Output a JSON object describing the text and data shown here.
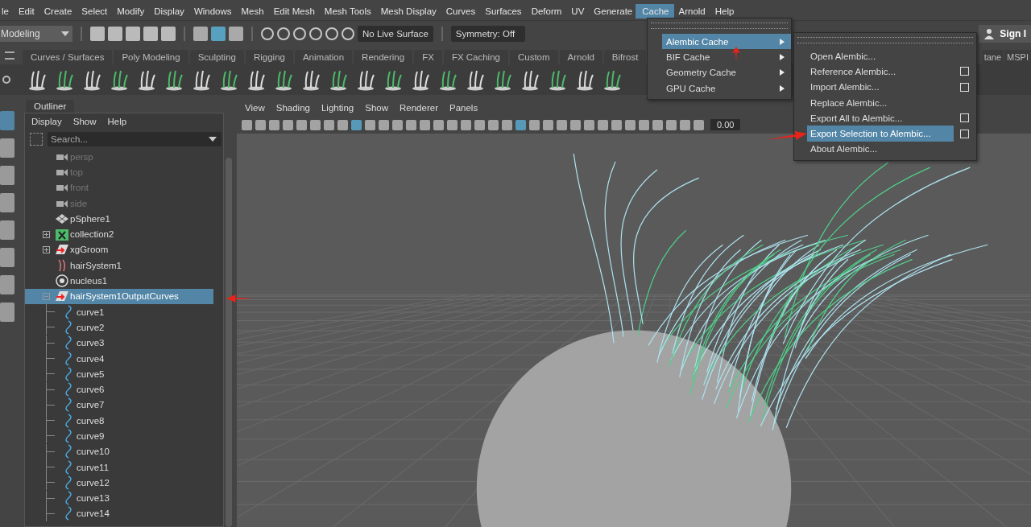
{
  "menu_bar": {
    "items": [
      {
        "label": "le",
        "selected": false
      },
      {
        "label": "Edit",
        "selected": false
      },
      {
        "label": "Create",
        "selected": false
      },
      {
        "label": "Select",
        "selected": false
      },
      {
        "label": "Modify",
        "selected": false
      },
      {
        "label": "Display",
        "selected": false
      },
      {
        "label": "Windows",
        "selected": false
      },
      {
        "label": "Mesh",
        "selected": false
      },
      {
        "label": "Edit Mesh",
        "selected": false
      },
      {
        "label": "Mesh Tools",
        "selected": false
      },
      {
        "label": "Mesh Display",
        "selected": false
      },
      {
        "label": "Curves",
        "selected": false
      },
      {
        "label": "Surfaces",
        "selected": false
      },
      {
        "label": "Deform",
        "selected": false
      },
      {
        "label": "UV",
        "selected": false
      },
      {
        "label": "Generate",
        "selected": false
      },
      {
        "label": "Cache",
        "selected": true
      },
      {
        "label": "Arnold",
        "selected": false
      },
      {
        "label": "Help",
        "selected": false
      }
    ]
  },
  "status_line": {
    "mode": "Modeling",
    "live_surface": "No Live Surface",
    "symmetry": "Symmetry: Off",
    "sign_in": "Sign I"
  },
  "shelf_tabs": [
    "Curves / Surfaces",
    "Poly Modeling",
    "Sculpting",
    "Rigging",
    "Animation",
    "Rendering",
    "FX",
    "FX Caching",
    "Custom",
    "Arnold",
    "Bifrost"
  ],
  "shelf_tabs_right": [
    "tane",
    "MSPI"
  ],
  "outliner": {
    "title": "Outliner",
    "menus": [
      "Display",
      "Show",
      "Help"
    ],
    "search": {
      "placeholder": "Search..."
    },
    "items": [
      {
        "label": "persp",
        "kind": "camera",
        "dimmed": true,
        "selected": false
      },
      {
        "label": "top",
        "kind": "camera",
        "dimmed": true,
        "selected": false
      },
      {
        "label": "front",
        "kind": "camera",
        "dimmed": true,
        "selected": false
      },
      {
        "label": "side",
        "kind": "camera",
        "dimmed": true,
        "selected": false
      },
      {
        "label": "pSphere1",
        "kind": "mesh",
        "dimmed": false,
        "selected": false
      },
      {
        "label": "collection2",
        "kind": "collection",
        "dimmed": false,
        "selected": false,
        "expanded": false
      },
      {
        "label": "xgGroom",
        "kind": "group",
        "dimmed": false,
        "selected": false,
        "expanded": false
      },
      {
        "label": "hairSystem1",
        "kind": "hair",
        "dimmed": false,
        "selected": false
      },
      {
        "label": "nucleus1",
        "kind": "nucleus",
        "dimmed": false,
        "selected": false
      },
      {
        "label": "hairSystem1OutputCurves",
        "kind": "group",
        "dimmed": false,
        "selected": true,
        "expanded": true,
        "children": [
          {
            "label": "curve1",
            "kind": "curve",
            "dimmed": false,
            "selected": false
          },
          {
            "label": "curve2",
            "kind": "curve",
            "dimmed": false,
            "selected": false
          },
          {
            "label": "curve3",
            "kind": "curve",
            "dimmed": false,
            "selected": false
          },
          {
            "label": "curve4",
            "kind": "curve",
            "dimmed": false,
            "selected": false
          },
          {
            "label": "curve5",
            "kind": "curve",
            "dimmed": false,
            "selected": false
          },
          {
            "label": "curve6",
            "kind": "curve",
            "dimmed": false,
            "selected": false
          },
          {
            "label": "curve7",
            "kind": "curve",
            "dimmed": false,
            "selected": false
          },
          {
            "label": "curve8",
            "kind": "curve",
            "dimmed": false,
            "selected": false
          },
          {
            "label": "curve9",
            "kind": "curve",
            "dimmed": false,
            "selected": false
          },
          {
            "label": "curve10",
            "kind": "curve",
            "dimmed": false,
            "selected": false
          },
          {
            "label": "curve11",
            "kind": "curve",
            "dimmed": false,
            "selected": false
          },
          {
            "label": "curve12",
            "kind": "curve",
            "dimmed": false,
            "selected": false
          },
          {
            "label": "curve13",
            "kind": "curve",
            "dimmed": false,
            "selected": false
          },
          {
            "label": "curve14",
            "kind": "curve",
            "dimmed": false,
            "selected": false
          }
        ]
      }
    ]
  },
  "viewport": {
    "menus": [
      "View",
      "Shading",
      "Lighting",
      "Show",
      "Renderer",
      "Panels"
    ],
    "exposure": "0.00"
  },
  "cache_menu": {
    "items": [
      {
        "label": "Alembic Cache",
        "selected": true,
        "submenu": true
      },
      {
        "label": "BIF Cache",
        "selected": false,
        "submenu": true
      },
      {
        "label": "Geometry Cache",
        "selected": false,
        "submenu": true
      },
      {
        "label": "GPU Cache",
        "selected": false,
        "submenu": true
      }
    ]
  },
  "alembic_menu": {
    "items": [
      {
        "label": "Open Alembic...",
        "selected": false,
        "option_box": false
      },
      {
        "label": "Reference Alembic...",
        "selected": false,
        "option_box": true
      },
      {
        "label": "Import Alembic...",
        "selected": false,
        "option_box": true
      },
      {
        "label": "Replace Alembic...",
        "selected": false,
        "option_box": false
      },
      {
        "label": "Export All to Alembic...",
        "selected": false,
        "option_box": true
      },
      {
        "label": "Export Selection to Alembic...",
        "selected": true,
        "option_box": true
      },
      {
        "label": "About Alembic...",
        "selected": false,
        "option_box": false
      }
    ]
  }
}
